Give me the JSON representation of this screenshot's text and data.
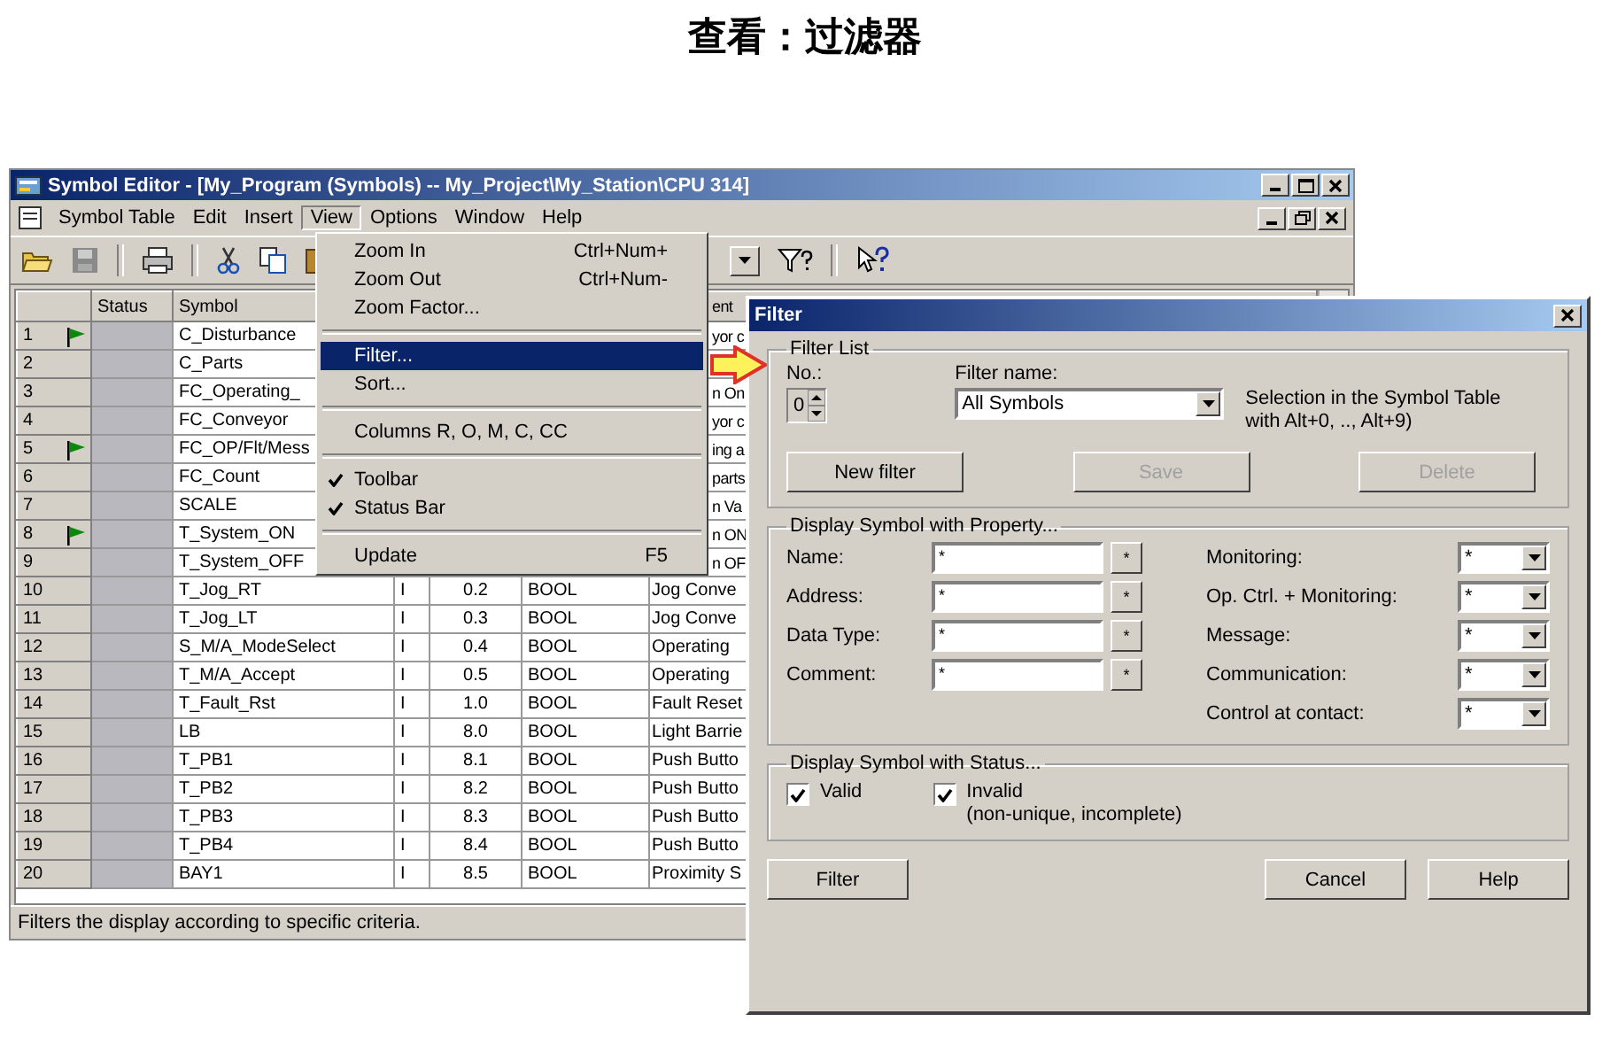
{
  "slide_title": "查看：过滤器",
  "window": {
    "title": "Symbol Editor - [My_Program (Symbols) -- My_Project\\My_Station\\CPU 314]"
  },
  "menu_bar": [
    {
      "label": "Symbol Table",
      "selected": false
    },
    {
      "label": "Edit",
      "selected": false
    },
    {
      "label": "Insert",
      "selected": false
    },
    {
      "label": "View",
      "selected": true
    },
    {
      "label": "Options",
      "selected": false
    },
    {
      "label": "Window",
      "selected": false
    },
    {
      "label": "Help",
      "selected": false
    }
  ],
  "table": {
    "headers": {
      "status": "Status",
      "symbol": "Symbol",
      "comment": "ent"
    },
    "rows": [
      {
        "no": "1",
        "flag": true,
        "symbol": "C_Disturbance",
        "comment": "yor c"
      },
      {
        "no": "2",
        "flag": false,
        "symbol": "C_Parts"
      },
      {
        "no": "3",
        "flag": false,
        "symbol": "FC_Operating_",
        "comment": "n On"
      },
      {
        "no": "4",
        "flag": false,
        "symbol": "FC_Conveyor",
        "comment": "yor c"
      },
      {
        "no": "5",
        "flag": true,
        "symbol": "FC_OP/Flt/Mess",
        "comment": "ing a"
      },
      {
        "no": "6",
        "flag": false,
        "symbol": "FC_Count",
        "comment": "parts"
      },
      {
        "no": "7",
        "flag": false,
        "symbol": "SCALE",
        "comment": "n Va"
      },
      {
        "no": "8",
        "flag": true,
        "symbol": "T_System_ON",
        "comment": "n ON"
      },
      {
        "no": "9",
        "flag": false,
        "symbol": "T_System_OFF",
        "comment": "n OF"
      },
      {
        "no": "10",
        "flag": false,
        "symbol": "T_Jog_RT",
        "io": "I",
        "address": "0.2",
        "type": "BOOL",
        "comment": "Jog Conve"
      },
      {
        "no": "11",
        "flag": false,
        "symbol": "T_Jog_LT",
        "io": "I",
        "address": "0.3",
        "type": "BOOL",
        "comment": "Jog Conve"
      },
      {
        "no": "12",
        "flag": false,
        "symbol": "S_M/A_ModeSelect",
        "io": "I",
        "address": "0.4",
        "type": "BOOL",
        "comment": "Operating"
      },
      {
        "no": "13",
        "flag": false,
        "symbol": "T_M/A_Accept",
        "io": "I",
        "address": "0.5",
        "type": "BOOL",
        "comment": "Operating"
      },
      {
        "no": "14",
        "flag": false,
        "symbol": "T_Fault_Rst",
        "io": "I",
        "address": "1.0",
        "type": "BOOL",
        "comment": "Fault Reset"
      },
      {
        "no": "15",
        "flag": false,
        "symbol": "LB",
        "io": "I",
        "address": "8.0",
        "type": "BOOL",
        "comment": "Light Barrie"
      },
      {
        "no": "16",
        "flag": false,
        "symbol": "T_PB1",
        "io": "I",
        "address": "8.1",
        "type": "BOOL",
        "comment": "Push Butto"
      },
      {
        "no": "17",
        "flag": false,
        "symbol": "T_PB2",
        "io": "I",
        "address": "8.2",
        "type": "BOOL",
        "comment": "Push Butto"
      },
      {
        "no": "18",
        "flag": false,
        "symbol": "T_PB3",
        "io": "I",
        "address": "8.3",
        "type": "BOOL",
        "comment": "Push Butto"
      },
      {
        "no": "19",
        "flag": false,
        "symbol": "T_PB4",
        "io": "I",
        "address": "8.4",
        "type": "BOOL",
        "comment": "Push Butto"
      },
      {
        "no": "20",
        "flag": false,
        "symbol": "BAY1",
        "io": "I",
        "address": "8.5",
        "type": "BOOL",
        "comment": "Proximity S"
      }
    ]
  },
  "status_bar": "Filters the display according to specific criteria.",
  "view_menu": [
    {
      "kind": "item",
      "label": "Zoom In",
      "shortcut": "Ctrl+Num+",
      "checked": false,
      "selected": false
    },
    {
      "kind": "item",
      "label": "Zoom Out",
      "shortcut": "Ctrl+Num-",
      "checked": false,
      "selected": false
    },
    {
      "kind": "item",
      "label": "Zoom Factor...",
      "checked": false,
      "selected": false
    },
    {
      "kind": "separator"
    },
    {
      "kind": "item",
      "label": "Filter...",
      "checked": false,
      "selected": true
    },
    {
      "kind": "item",
      "label": "Sort...",
      "checked": false,
      "selected": false
    },
    {
      "kind": "separator"
    },
    {
      "kind": "item",
      "label": "Columns R, O, M, C, CC",
      "checked": false,
      "selected": false
    },
    {
      "kind": "separator"
    },
    {
      "kind": "item",
      "label": "Toolbar",
      "checked": true,
      "selected": false
    },
    {
      "kind": "item",
      "label": "Status Bar",
      "checked": true,
      "selected": false
    },
    {
      "kind": "separator"
    },
    {
      "kind": "item",
      "label": "Update",
      "shortcut": "F5",
      "checked": false,
      "selected": false
    }
  ],
  "filter_dialog": {
    "title": "Filter",
    "filter_list": {
      "title": "Filter List",
      "number_label": "No.:",
      "number": "0",
      "name_label": "Filter name:",
      "name": "All Symbols",
      "note": "Selection in the Symbol Table with Alt+0, .., Alt+9)",
      "buttons": [
        {
          "label": "New filter",
          "disabled": false
        },
        {
          "label": "Save",
          "disabled": true
        },
        {
          "label": "Delete",
          "disabled": true
        }
      ]
    },
    "property": {
      "title": "Display Symbol with Property...",
      "fields": [
        {
          "label": "Name:",
          "value": "*",
          "button": "*"
        },
        {
          "label": "Address:",
          "value": "*",
          "button": "*"
        },
        {
          "label": "Data Type:",
          "value": "*",
          "button": "*"
        },
        {
          "label": "Comment:",
          "value": "*",
          "button": "*"
        }
      ],
      "selects": [
        {
          "label": "Monitoring:",
          "value": "*"
        },
        {
          "label": "Op. Ctrl. + Monitoring:",
          "value": "*"
        },
        {
          "label": "Message:",
          "value": "*"
        },
        {
          "label": "Communication:",
          "value": "*"
        },
        {
          "label": "Control at contact:",
          "value": "*"
        }
      ]
    },
    "status": {
      "title": "Display Symbol with Status...",
      "checkboxes": [
        {
          "label": "Valid",
          "checked": true
        },
        {
          "label": "Invalid",
          "note": "(non-unique, incomplete)",
          "checked": true
        }
      ]
    },
    "buttons": [
      {
        "label": "Filter",
        "disabled": false
      },
      {
        "label": "Cancel",
        "disabled": false
      },
      {
        "label": "Help",
        "disabled": false
      }
    ]
  }
}
